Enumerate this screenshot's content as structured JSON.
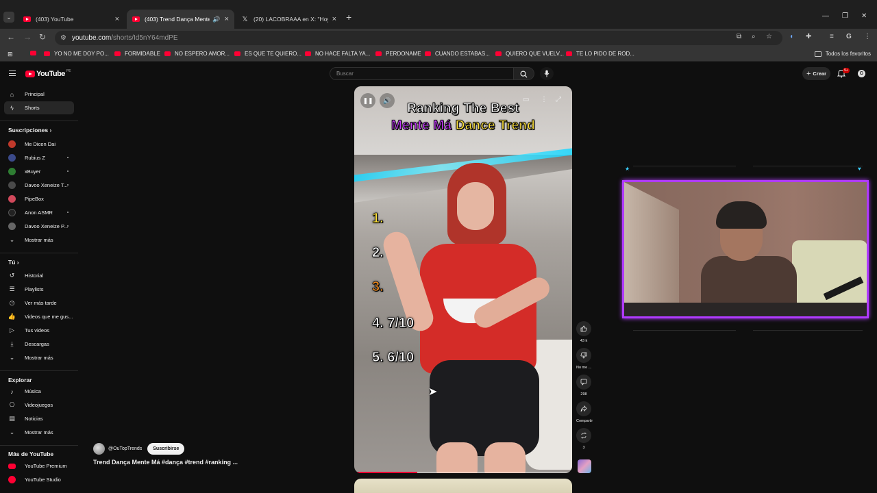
{
  "browser": {
    "tabs": [
      {
        "title": "(403) YouTube",
        "active": false,
        "icon": "youtube-icon"
      },
      {
        "title": "(403) Trend Dança Mente M",
        "active": true,
        "icon": "youtube-icon"
      },
      {
        "title": "(20) LACOBRAAA en X: \"Hoy m",
        "active": false,
        "icon": "x-icon"
      }
    ],
    "url_host": "youtube.com",
    "url_path": "/shorts/Id5nY64mdPE",
    "bookmarks": [
      "YO NO ME DOY PO...",
      "FORMIDABLE",
      "NO ESPERO AMOR...",
      "ES QUE TE QUIERO...",
      "NO HACE FALTA YA...",
      "PERDONAME",
      "CUANDO ESTABAS...",
      "QUIERO QUE VUELV...",
      "TE LO PIDO DE ROD..."
    ],
    "bookmarks_all": "Todos los favoritos"
  },
  "youtube": {
    "logo_text": "YouTube",
    "country_code": "PE",
    "search_placeholder": "Buscar",
    "create_label": "Crear",
    "notifications_count": "9+",
    "account_initial": "G",
    "sidebar": {
      "main": [
        {
          "label": "Principal",
          "icon": "home-icon"
        },
        {
          "label": "Shorts",
          "icon": "shorts-icon",
          "active": true
        }
      ],
      "subscriptions_heading": "Suscripciones",
      "subscriptions": [
        {
          "label": "Me Dicen Dai",
          "color": "#c0392b",
          "dot": false
        },
        {
          "label": "Rubius Z",
          "color": "#3b4a8a",
          "dot": true
        },
        {
          "label": "xBuyer",
          "color": "#2e7d32",
          "dot": true
        },
        {
          "label": "Davoo Xeneize T...",
          "color": "#4a4a4a",
          "dot": true
        },
        {
          "label": "PipeBox",
          "color": "#d1495b",
          "dot": false
        },
        {
          "label": "Anon ASMR",
          "color": "#222222",
          "dot": true
        },
        {
          "label": "Davoo Xeneize P...",
          "color": "#666666",
          "dot": true
        }
      ],
      "subscriptions_more": "Mostrar más",
      "you_heading": "Tú",
      "you": [
        {
          "label": "Historial",
          "icon": "history-icon"
        },
        {
          "label": "Playlists",
          "icon": "playlist-icon"
        },
        {
          "label": "Ver más tarde",
          "icon": "clock-icon"
        },
        {
          "label": "Videos que me gus...",
          "icon": "thumbs-up-icon"
        },
        {
          "label": "Tus videos",
          "icon": "play-square-icon"
        },
        {
          "label": "Descargas",
          "icon": "download-icon"
        }
      ],
      "you_more": "Mostrar más",
      "explore_heading": "Explorar",
      "explore": [
        {
          "label": "Música",
          "icon": "music-icon"
        },
        {
          "label": "Videojuegos",
          "icon": "gamepad-icon"
        },
        {
          "label": "Noticias",
          "icon": "news-icon"
        }
      ],
      "explore_more": "Mostrar más",
      "more_heading": "Más de YouTube",
      "more": [
        {
          "label": "YouTube Premium",
          "color": "#ff0033"
        },
        {
          "label": "YouTube Studio",
          "color": "#ff0033"
        }
      ]
    },
    "short": {
      "overlay_line1": "Ranking The Best",
      "overlay_line2_a": "Mente Má",
      "overlay_line2_b": "Dance Trend",
      "ranks": [
        "1.",
        "2.",
        "3.",
        "4. 7/10",
        "5. 6/10"
      ],
      "progress": 0.29,
      "channel": "@OuTopTrends",
      "subscribe_label": "Suscribirse",
      "caption": "Trend Dança Mente Má #dança #trend #ranking ..."
    },
    "actions": {
      "likes": "43 k",
      "dislike": "No me ...",
      "comments": "298",
      "share": "Compartir",
      "remix": "3"
    }
  },
  "colors": {
    "accent": "#ff0033",
    "cam_border": "#b03bff",
    "rank_yellow": "#ffe23a",
    "rank_orange": "#f08a1c",
    "title_magenta": "#c637ff"
  }
}
